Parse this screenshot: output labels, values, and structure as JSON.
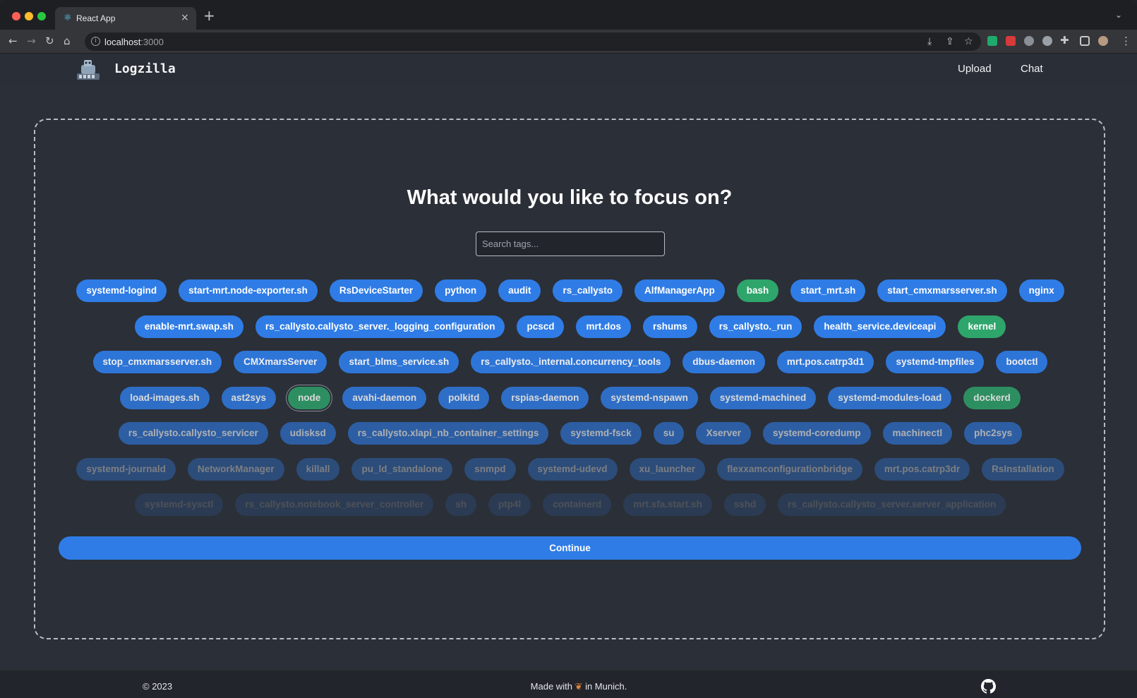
{
  "browser": {
    "tab_title": "React App",
    "url_host": "localhost",
    "url_port": ":3000"
  },
  "header": {
    "brand": "Logzilla",
    "nav": {
      "upload": "Upload",
      "chat": "Chat"
    }
  },
  "main": {
    "heading": "What would you like to focus on?",
    "search_placeholder": "Search tags...",
    "continue_label": "Continue",
    "tag_rows": [
      [
        {
          "label": "systemd-logind",
          "selected": false
        },
        {
          "label": "start-mrt.node-exporter.sh",
          "selected": false
        },
        {
          "label": "RsDeviceStarter",
          "selected": false
        },
        {
          "label": "python",
          "selected": false
        },
        {
          "label": "audit",
          "selected": false
        },
        {
          "label": "rs_callysto",
          "selected": false
        },
        {
          "label": "AlfManagerApp",
          "selected": false
        },
        {
          "label": "bash",
          "selected": true
        },
        {
          "label": "start_mrt.sh",
          "selected": false
        },
        {
          "label": "start_cmxmarsserver.sh",
          "selected": false
        },
        {
          "label": "nginx",
          "selected": false
        }
      ],
      [
        {
          "label": "enable-mrt.swap.sh",
          "selected": false
        },
        {
          "label": "rs_callysto.callysto_server._logging_configuration",
          "selected": false
        },
        {
          "label": "pcscd",
          "selected": false
        },
        {
          "label": "mrt.dos",
          "selected": false
        },
        {
          "label": "rshums",
          "selected": false
        },
        {
          "label": "rs_callysto._run",
          "selected": false
        },
        {
          "label": "health_service.deviceapi",
          "selected": false
        },
        {
          "label": "kernel",
          "selected": true
        }
      ],
      [
        {
          "label": "stop_cmxmarsserver.sh",
          "selected": false
        },
        {
          "label": "CMXmarsServer",
          "selected": false
        },
        {
          "label": "start_blms_service.sh",
          "selected": false
        },
        {
          "label": "rs_callysto._internal.concurrency_tools",
          "selected": false
        },
        {
          "label": "dbus-daemon",
          "selected": false
        },
        {
          "label": "mrt.pos.catrp3d1",
          "selected": false
        },
        {
          "label": "systemd-tmpfiles",
          "selected": false
        },
        {
          "label": "bootctl",
          "selected": false
        }
      ],
      [
        {
          "label": "load-images.sh",
          "selected": false
        },
        {
          "label": "ast2sys",
          "selected": false
        },
        {
          "label": "node",
          "selected": true,
          "focused": true
        },
        {
          "label": "avahi-daemon",
          "selected": false
        },
        {
          "label": "polkitd",
          "selected": false
        },
        {
          "label": "rspias-daemon",
          "selected": false
        },
        {
          "label": "systemd-nspawn",
          "selected": false
        },
        {
          "label": "systemd-machined",
          "selected": false
        },
        {
          "label": "systemd-modules-load",
          "selected": false
        },
        {
          "label": "dockerd",
          "selected": true
        }
      ],
      [
        {
          "label": "rs_callysto.callysto_servicer",
          "selected": false
        },
        {
          "label": "udisksd",
          "selected": false
        },
        {
          "label": "rs_callysto.xlapi_nb_container_settings",
          "selected": false
        },
        {
          "label": "systemd-fsck",
          "selected": false
        },
        {
          "label": "su",
          "selected": false
        },
        {
          "label": "Xserver",
          "selected": false
        },
        {
          "label": "systemd-coredump",
          "selected": false
        },
        {
          "label": "machinectl",
          "selected": false
        },
        {
          "label": "phc2sys",
          "selected": false
        }
      ],
      [
        {
          "label": "systemd-journald",
          "selected": false
        },
        {
          "label": "NetworkManager",
          "selected": false
        },
        {
          "label": "killall",
          "selected": false
        },
        {
          "label": "pu_ld_standalone",
          "selected": false
        },
        {
          "label": "snmpd",
          "selected": false
        },
        {
          "label": "systemd-udevd",
          "selected": false
        },
        {
          "label": "xu_launcher",
          "selected": false
        },
        {
          "label": "flexxamconfigurationbridge",
          "selected": false
        },
        {
          "label": "mrt.pos.catrp3dr",
          "selected": false
        },
        {
          "label": "RsInstallation",
          "selected": false
        }
      ],
      [
        {
          "label": "systemd-sysctl",
          "selected": false
        },
        {
          "label": "rs_callysto.notebook_server_controller",
          "selected": false
        },
        {
          "label": "sh",
          "selected": false
        },
        {
          "label": "ptp4l",
          "selected": false
        },
        {
          "label": "containerd",
          "selected": false
        },
        {
          "label": "mrt.sfa.start.sh",
          "selected": false
        },
        {
          "label": "sshd",
          "selected": false
        },
        {
          "label": "rs_callysto.callysto_server.server_application",
          "selected": false
        }
      ]
    ]
  },
  "footer": {
    "copyright": "© 2023",
    "made_prefix": "Made with",
    "made_suffix": "in Munich."
  },
  "colors": {
    "accent": "#2f7ce6",
    "selected": "#2ea56b",
    "background": "#2b2f37"
  },
  "icons": [
    "react-icon",
    "close-icon",
    "plus-icon",
    "back-icon",
    "forward-icon",
    "reload-icon",
    "home-icon",
    "info-icon",
    "download-icon",
    "share-icon",
    "star-icon",
    "extensions-icon",
    "sidebar-icon",
    "profile-icon",
    "menu-icon",
    "logo-icon",
    "pretzel-icon",
    "github-icon"
  ]
}
